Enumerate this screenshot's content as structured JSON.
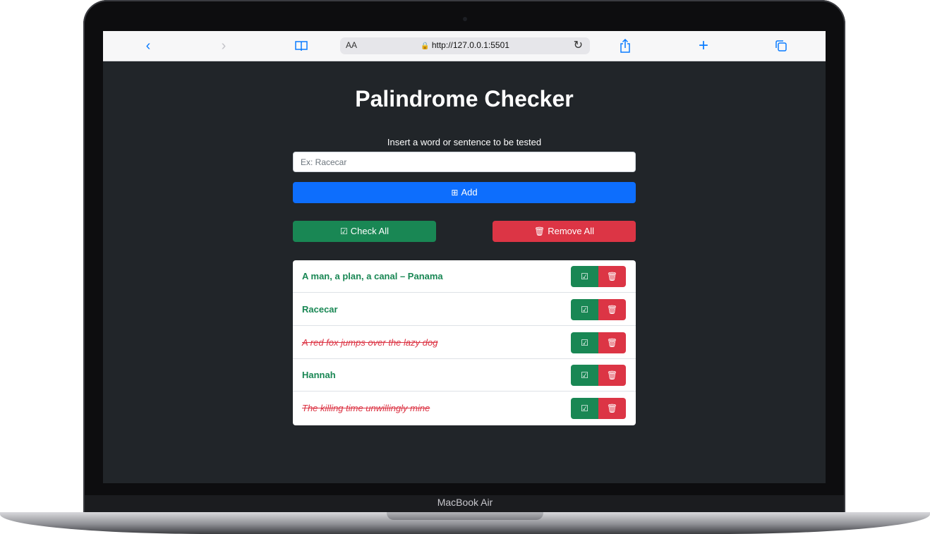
{
  "device": {
    "model_label": "MacBook Air"
  },
  "browser": {
    "text_size_label": "AA",
    "url": "http://127.0.0.1:5501",
    "icons": [
      "back-icon",
      "forward-icon",
      "bookmarks-icon",
      "lock-icon",
      "reload-icon",
      "share-icon",
      "new-tab-icon",
      "tabs-icon"
    ]
  },
  "app": {
    "title": "Palindrome Checker",
    "prompt": "Insert a word or sentence to be tested",
    "input": {
      "value": "",
      "placeholder": "Ex: Racecar"
    },
    "add_button": "Add",
    "check_all_button": "Check All",
    "remove_all_button": "Remove All",
    "items": [
      {
        "text": "A man, a plan, a canal – Panama",
        "status": "palindrome"
      },
      {
        "text": "Racecar",
        "status": "palindrome"
      },
      {
        "text": "A red fox jumps over the lazy dog",
        "status": "not-palindrome"
      },
      {
        "text": "Hannah",
        "status": "palindrome"
      },
      {
        "text": "The killing time unwillingly mine",
        "status": "not-palindrome"
      }
    ]
  },
  "colors": {
    "page_bg": "#212529",
    "primary": "#0d6efd",
    "success": "#198754",
    "danger": "#dc3545"
  }
}
